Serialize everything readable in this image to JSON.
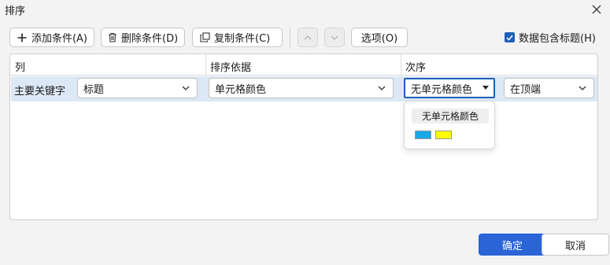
{
  "window": {
    "title": "排序"
  },
  "toolbar": {
    "add_label": "添加条件(A)",
    "delete_label": "删除条件(D)",
    "copy_label": "复制条件(C)",
    "options_label": "选项(O)",
    "header_checkbox_label": "数据包含标题(H)",
    "header_checkbox_checked": true
  },
  "table": {
    "headers": [
      "列",
      "排序依据",
      "次序"
    ],
    "rows": [
      {
        "label": "主要关键字",
        "column": "标题",
        "sort_on": "单元格颜色",
        "color": "无单元格颜色",
        "position": "在顶端"
      }
    ]
  },
  "color_popup": {
    "option_label": "无单元格颜色",
    "swatches": [
      "#1aa7e8",
      "#ffff00"
    ]
  },
  "footer": {
    "ok_label": "确定",
    "cancel_label": "取消"
  },
  "colors": {
    "accent": "#2a64d6",
    "selected_row": "#dde8f6"
  }
}
